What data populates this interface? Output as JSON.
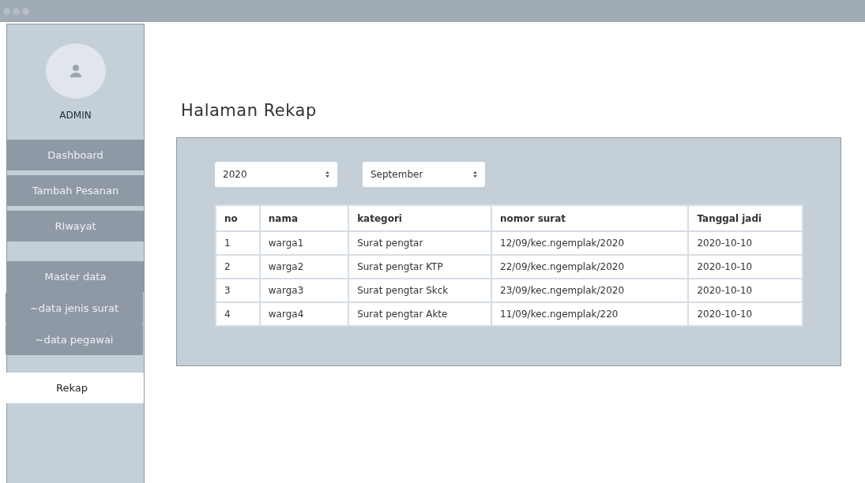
{
  "sidebar": {
    "user": "ADMIN",
    "items": [
      {
        "label": "Dashboard",
        "kind": "main",
        "selected": false
      },
      {
        "label": "Tambah Pesanan",
        "kind": "main",
        "selected": false
      },
      {
        "label": "RIwayat",
        "kind": "main",
        "selected": false
      },
      {
        "label": "Master data",
        "kind": "section",
        "selected": false
      },
      {
        "label": "~data jenis surat",
        "kind": "sub",
        "selected": false
      },
      {
        "label": "~data pegawai",
        "kind": "sub",
        "selected": false
      },
      {
        "label": "Rekap",
        "kind": "main",
        "selected": true
      }
    ]
  },
  "page": {
    "title": "Halaman Rekap",
    "filters": [
      {
        "value": "2020"
      },
      {
        "value": "September"
      }
    ],
    "table": {
      "columns": [
        "no",
        "nama",
        "kategori",
        "nomor surat",
        "Tanggal jadi"
      ],
      "rows": [
        [
          "1",
          "warga1",
          "Surat pengtar",
          "12/09/kec.ngemplak/2020",
          "2020-10-10"
        ],
        [
          "2",
          "warga2",
          "Surat pengtar KTP",
          "22/09/kec.ngemplak/2020",
          "2020-10-10"
        ],
        [
          "3",
          "warga3",
          "Surat pengtar Skck",
          "23/09/kec.ngemplak/2020",
          "2020-10-10"
        ],
        [
          "4",
          "warga4",
          "Surat pengtar Akte",
          "11/09/kec.ngemplak/220",
          "2020-10-10"
        ]
      ]
    }
  }
}
